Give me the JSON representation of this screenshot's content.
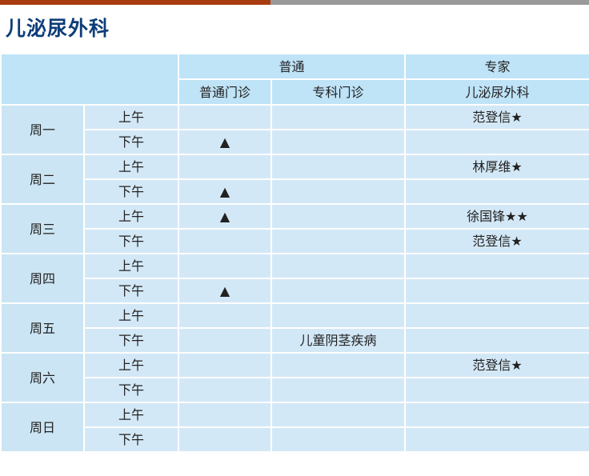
{
  "page_title": "儿泌尿外科",
  "header": {
    "group_general": "普通",
    "group_expert": "专家",
    "col_general_clinic": "普通门诊",
    "col_special_clinic": "专科门诊",
    "col_expert_dept": "儿泌尿外科"
  },
  "days": [
    {
      "day": "周一",
      "slots": [
        {
          "period": "上午",
          "general": "",
          "special": "",
          "expert": "范登信★"
        },
        {
          "period": "下午",
          "general": "▲",
          "special": "",
          "expert": ""
        }
      ]
    },
    {
      "day": "周二",
      "slots": [
        {
          "period": "上午",
          "general": "",
          "special": "",
          "expert": "林厚维★"
        },
        {
          "period": "下午",
          "general": "▲",
          "special": "",
          "expert": ""
        }
      ]
    },
    {
      "day": "周三",
      "slots": [
        {
          "period": "上午",
          "general": "▲",
          "special": "",
          "expert": "徐国锋★★"
        },
        {
          "period": "下午",
          "general": "",
          "special": "",
          "expert": "范登信★"
        }
      ]
    },
    {
      "day": "周四",
      "slots": [
        {
          "period": "上午",
          "general": "",
          "special": "",
          "expert": ""
        },
        {
          "period": "下午",
          "general": "▲",
          "special": "",
          "expert": ""
        }
      ]
    },
    {
      "day": "周五",
      "slots": [
        {
          "period": "上午",
          "general": "",
          "special": "",
          "expert": ""
        },
        {
          "period": "下午",
          "general": "",
          "special": "儿童阴茎疾病",
          "expert": ""
        }
      ]
    },
    {
      "day": "周六",
      "slots": [
        {
          "period": "上午",
          "general": "",
          "special": "",
          "expert": "范登信★"
        },
        {
          "period": "下午",
          "general": "",
          "special": "",
          "expert": ""
        }
      ]
    },
    {
      "day": "周日",
      "slots": [
        {
          "period": "上午",
          "general": "",
          "special": "",
          "expert": ""
        },
        {
          "period": "下午",
          "general": "",
          "special": "",
          "expert": ""
        }
      ]
    }
  ],
  "colors": {
    "title": "#0d3d78",
    "header_bg": "#bfe3f7",
    "cell_bg": "#d3e8f7",
    "accent_bar": "#a93c0e",
    "gray_bar": "#999999"
  }
}
